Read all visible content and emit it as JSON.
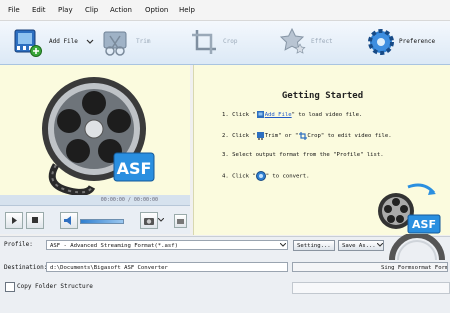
{
  "menu": [
    "File",
    "Edit",
    "Play",
    "Clip",
    "Action",
    "Option",
    "Help"
  ],
  "toolbar": {
    "add_file": "Add File",
    "trim": "Trim",
    "crop": "Crop",
    "effect": "Effect",
    "preference": "Preference"
  },
  "preview": {
    "badge": "ASF",
    "time": "00:00:00 / 00:00:00"
  },
  "getting_started": {
    "title": "Getting Started",
    "step1_a": "1. Click \"",
    "step1_link": "Add File",
    "step1_b": "\" to load video file.",
    "step2_a": "2. Click \"",
    "step2_b": "Trim\" or \"",
    "step2_c": "Crop\" to edit video file.",
    "step3": "3. Select output format from the \"Profile\" list.",
    "step4_a": "4. Click \"",
    "step4_b": "\" to convert.",
    "logo_badge": "ASF"
  },
  "bottom": {
    "profile_label": "Profile:",
    "profile_value": "ASF - Advanced Streaming Format(*.asf)",
    "settings_button": "Setting...",
    "save_as_button": "Save As...",
    "destination_label": "Destination:",
    "destination_value": "d:\\Documents\\Bigasoft ASF Converter",
    "dest_status": "Sing Formsormat Formats",
    "copy_folder_label": "Copy Folder Structure"
  },
  "colors": {
    "accent": "#1f58c8",
    "panel": "#fbfbde",
    "toolbar_top": "#f4f8fd",
    "toolbar_bottom": "#dce9f6"
  }
}
